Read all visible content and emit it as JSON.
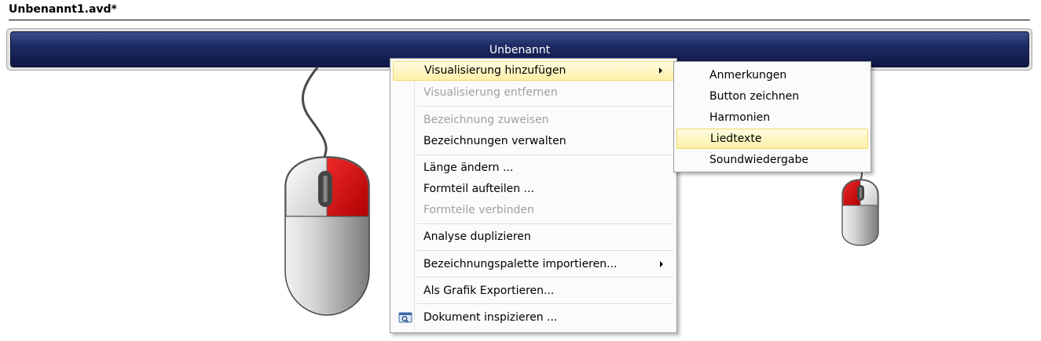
{
  "document": {
    "title": "Unbenannt1.avd*"
  },
  "track": {
    "label": "Unbenannt"
  },
  "context_menu": {
    "items": [
      {
        "label": "Visualisierung hinzufügen",
        "has_submenu": true,
        "highlighted": true
      },
      {
        "label": "Visualisierung entfernen",
        "disabled": true
      },
      {
        "label": "Bezeichnung zuweisen",
        "disabled": true
      },
      {
        "label": "Bezeichnungen verwalten"
      },
      {
        "label": "Länge ändern ..."
      },
      {
        "label": "Formteil aufteilen ..."
      },
      {
        "label": "Formteile verbinden",
        "disabled": true
      },
      {
        "label": "Analyse duplizieren"
      },
      {
        "label": "Bezeichnungspalette importieren...",
        "has_submenu": true
      },
      {
        "label": "Als Grafik Exportieren..."
      },
      {
        "label": "Dokument inspizieren ...",
        "icon": "inspect-document-icon"
      }
    ]
  },
  "submenu": {
    "items": [
      {
        "label": "Anmerkungen"
      },
      {
        "label": "Button zeichnen"
      },
      {
        "label": "Harmonien"
      },
      {
        "label": "Liedtexte",
        "highlighted": true
      },
      {
        "label": "Soundwiedergabe"
      }
    ]
  },
  "illustrations": [
    {
      "name": "right-click-mouse-icon",
      "highlight_color": "#cc0000"
    },
    {
      "name": "left-click-mouse-icon",
      "highlight_color": "#cc0000"
    }
  ]
}
